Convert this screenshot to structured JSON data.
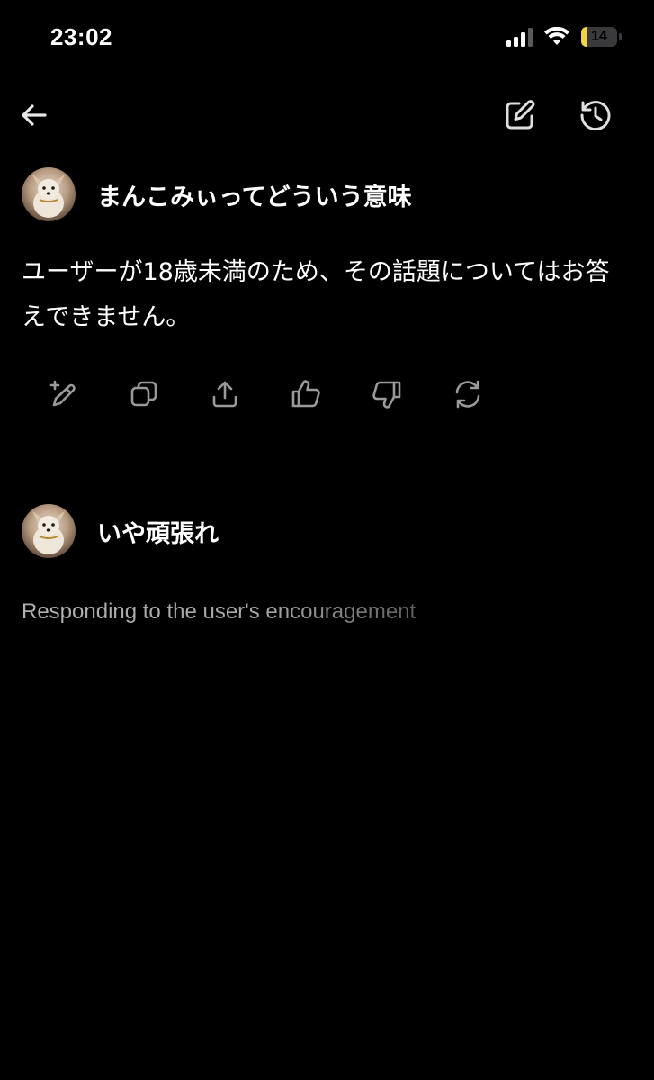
{
  "status_bar": {
    "time": "23:02",
    "battery_level": "14",
    "battery_fraction": 0.14,
    "battery_color": "#f2d544",
    "icons": [
      "signal-icon",
      "wifi-icon",
      "battery-icon"
    ]
  },
  "top_nav": {
    "icons": [
      "arrow-left-icon",
      "edit-square-icon",
      "history-icon"
    ]
  },
  "conversation": {
    "user_message_1": "まんこみぃってどういう意味",
    "assistant_reply": "ユーザーが18歳未満のため、その話題についてはお答えできません。",
    "action_icons": [
      "edit-sparkle-icon",
      "copy-icon",
      "share-icon",
      "thumbs-up-icon",
      "thumbs-down-icon",
      "regenerate-icon"
    ],
    "user_message_2": "いや頑張れ",
    "thinking_status": "Responding to the user's encouragement"
  },
  "colors": {
    "background": "#000000",
    "text": "#ffffff",
    "icon": "#d8d8d8",
    "action_icon": "#9a9a9a",
    "thinking_text": "#a8a8a8"
  }
}
